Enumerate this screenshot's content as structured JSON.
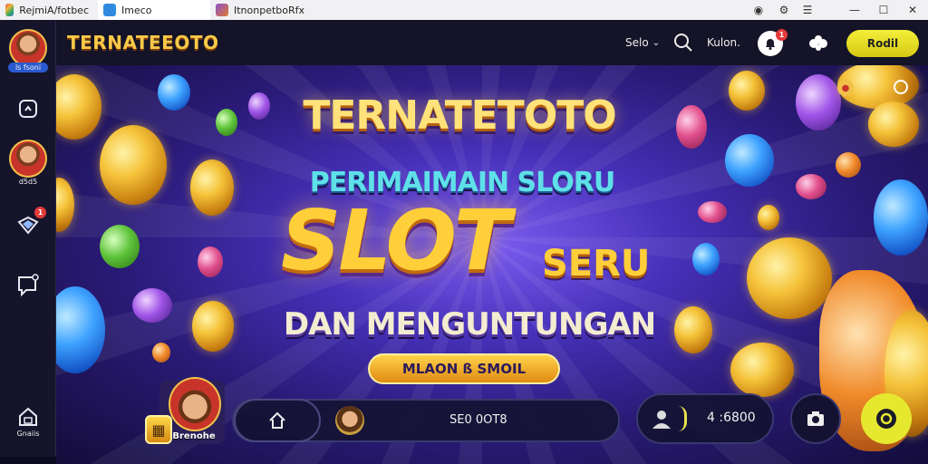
{
  "tabs": [
    {
      "label": "RejmiA/fotbec"
    },
    {
      "label": "Imeco"
    },
    {
      "label": "ItnonpetboRfx"
    }
  ],
  "window_controls": [
    "location-icon",
    "settings-icon",
    "menu-icon",
    "minimize-icon",
    "maximize-icon",
    "close-icon"
  ],
  "sidebar": {
    "profile_label": "ls fsoni",
    "items": [
      {
        "icon": "screen-icon",
        "label": ""
      },
      {
        "icon": "avatar",
        "label": "d5d5"
      },
      {
        "icon": "gem-icon",
        "badge": "1",
        "label": ""
      },
      {
        "icon": "chat-icon",
        "label": ""
      },
      {
        "icon": "home-icon",
        "label": "Gnaiis"
      }
    ]
  },
  "header": {
    "brand": "TERNATEEOTO",
    "language": "Selo",
    "search_label": "Kulon.",
    "notification_badge": "1",
    "action_button": "Rodil"
  },
  "banner": {
    "title": "TERNATETOTO",
    "subtitle": "PERIMAIMAIN SLORU",
    "headline": "SLOT",
    "headline_suffix": "SERU",
    "tagline": "DAN MENGUNTUNGAN",
    "cta": "MLAON ß SMOIL"
  },
  "bottom_bar": {
    "player_name": "Brenohe",
    "pill_value": "SE0 0OT8",
    "balance": "4 :6800"
  },
  "colors": {
    "accent_yellow": "#f4ef3a",
    "brand_gold": "#f7c948",
    "banner_purple": "#4630b8",
    "badge_red": "#e23a3a"
  }
}
